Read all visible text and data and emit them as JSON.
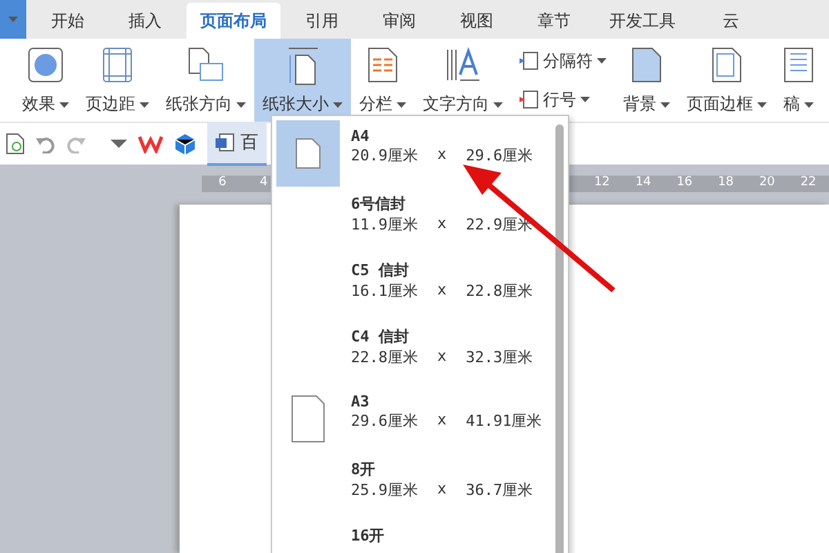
{
  "app_tabs": [
    {
      "label": "开始",
      "selected": false
    },
    {
      "label": "插入",
      "selected": false
    },
    {
      "label": "页面布局",
      "selected": true
    },
    {
      "label": "引用",
      "selected": false
    },
    {
      "label": "审阅",
      "selected": false
    },
    {
      "label": "视图",
      "selected": false
    },
    {
      "label": "章节",
      "selected": false
    },
    {
      "label": "开发工具",
      "selected": false
    },
    {
      "label": "云",
      "selected": false
    }
  ],
  "ribbon": {
    "items": [
      {
        "kind": "large",
        "label": "效果",
        "selected": false
      },
      {
        "kind": "large",
        "label": "页边距",
        "selected": false
      },
      {
        "kind": "large",
        "label": "纸张方向",
        "selected": false
      },
      {
        "kind": "large",
        "label": "纸张大小",
        "selected": true
      },
      {
        "kind": "large",
        "label": "分栏",
        "selected": false
      },
      {
        "kind": "large",
        "label": "文字方向",
        "selected": false
      },
      {
        "kind": "stack",
        "labels": [
          "分隔符",
          "行号"
        ],
        "selected": false
      },
      {
        "kind": "large",
        "label": "背景",
        "selected": false
      },
      {
        "kind": "large",
        "label": "页面边框",
        "selected": false
      },
      {
        "kind": "large",
        "label": "稿",
        "selected": false
      }
    ]
  },
  "document_tab": {
    "label": "百"
  },
  "ruler": {
    "ticks": [
      "6",
      "4",
      "12",
      "14",
      "16",
      "18",
      "20",
      "22"
    ]
  },
  "paper_sizes": [
    {
      "kind": "icon",
      "name": "A4",
      "width": "20.9厘米",
      "times": "x",
      "height": "29.6厘米",
      "selected": true
    },
    {
      "kind": "plain",
      "name": "6号信封",
      "width": "11.9厘米",
      "times": "x",
      "height": "22.9厘米",
      "selected": false
    },
    {
      "kind": "plain",
      "name": "C5 信封",
      "width": "16.1厘米",
      "times": "x",
      "height": "22.8厘米",
      "selected": false
    },
    {
      "kind": "plain",
      "name": "C4 信封",
      "width": "22.8厘米",
      "times": "x",
      "height": "32.3厘米",
      "selected": false
    },
    {
      "kind": "icon",
      "name": "A3",
      "width": "29.6厘米",
      "times": "x",
      "height": "41.91厘米",
      "selected": false
    },
    {
      "kind": "plain",
      "name": "8开",
      "width": "25.9厘米",
      "times": "x",
      "height": "36.7厘米",
      "selected": false
    },
    {
      "kind": "plain",
      "name": "16开",
      "selected": false
    }
  ]
}
